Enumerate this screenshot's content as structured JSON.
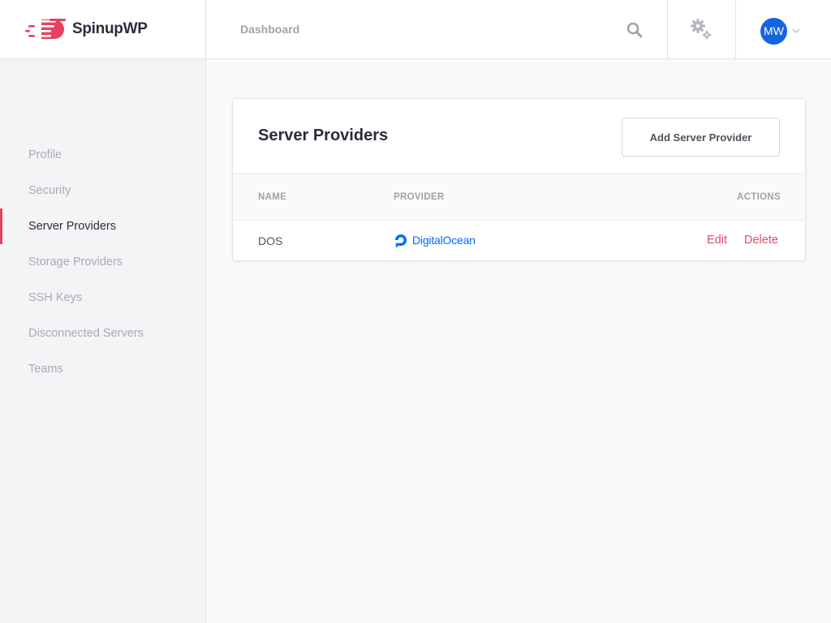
{
  "brand": {
    "name": "SpinupWP",
    "accent": "#e8415f"
  },
  "header": {
    "nav": {
      "dashboard": "Dashboard"
    },
    "icons": {
      "search": "search-icon",
      "settings": "gear-icon",
      "user_menu": "chevron-down-icon"
    },
    "user": {
      "initials": "MW",
      "avatar_color": "#1464e0"
    }
  },
  "sidebar": {
    "items": [
      {
        "label": "Profile",
        "active": false
      },
      {
        "label": "Security",
        "active": false
      },
      {
        "label": "Server Providers",
        "active": true
      },
      {
        "label": "Storage Providers",
        "active": false
      },
      {
        "label": "SSH Keys",
        "active": false
      },
      {
        "label": "Disconnected Servers",
        "active": false
      },
      {
        "label": "Teams",
        "active": false
      }
    ]
  },
  "main": {
    "title": "Server Providers",
    "add_button": "Add Server Provider",
    "table": {
      "columns": {
        "name": "NAME",
        "provider": "PROVIDER",
        "actions": "ACTIONS"
      },
      "rows": [
        {
          "name": "DOS",
          "provider": "DigitalOcean",
          "edit": "Edit",
          "delete": "Delete"
        }
      ]
    }
  },
  "colors": {
    "provider_brand": "#0069ff",
    "action_link": "#e04a5f"
  }
}
